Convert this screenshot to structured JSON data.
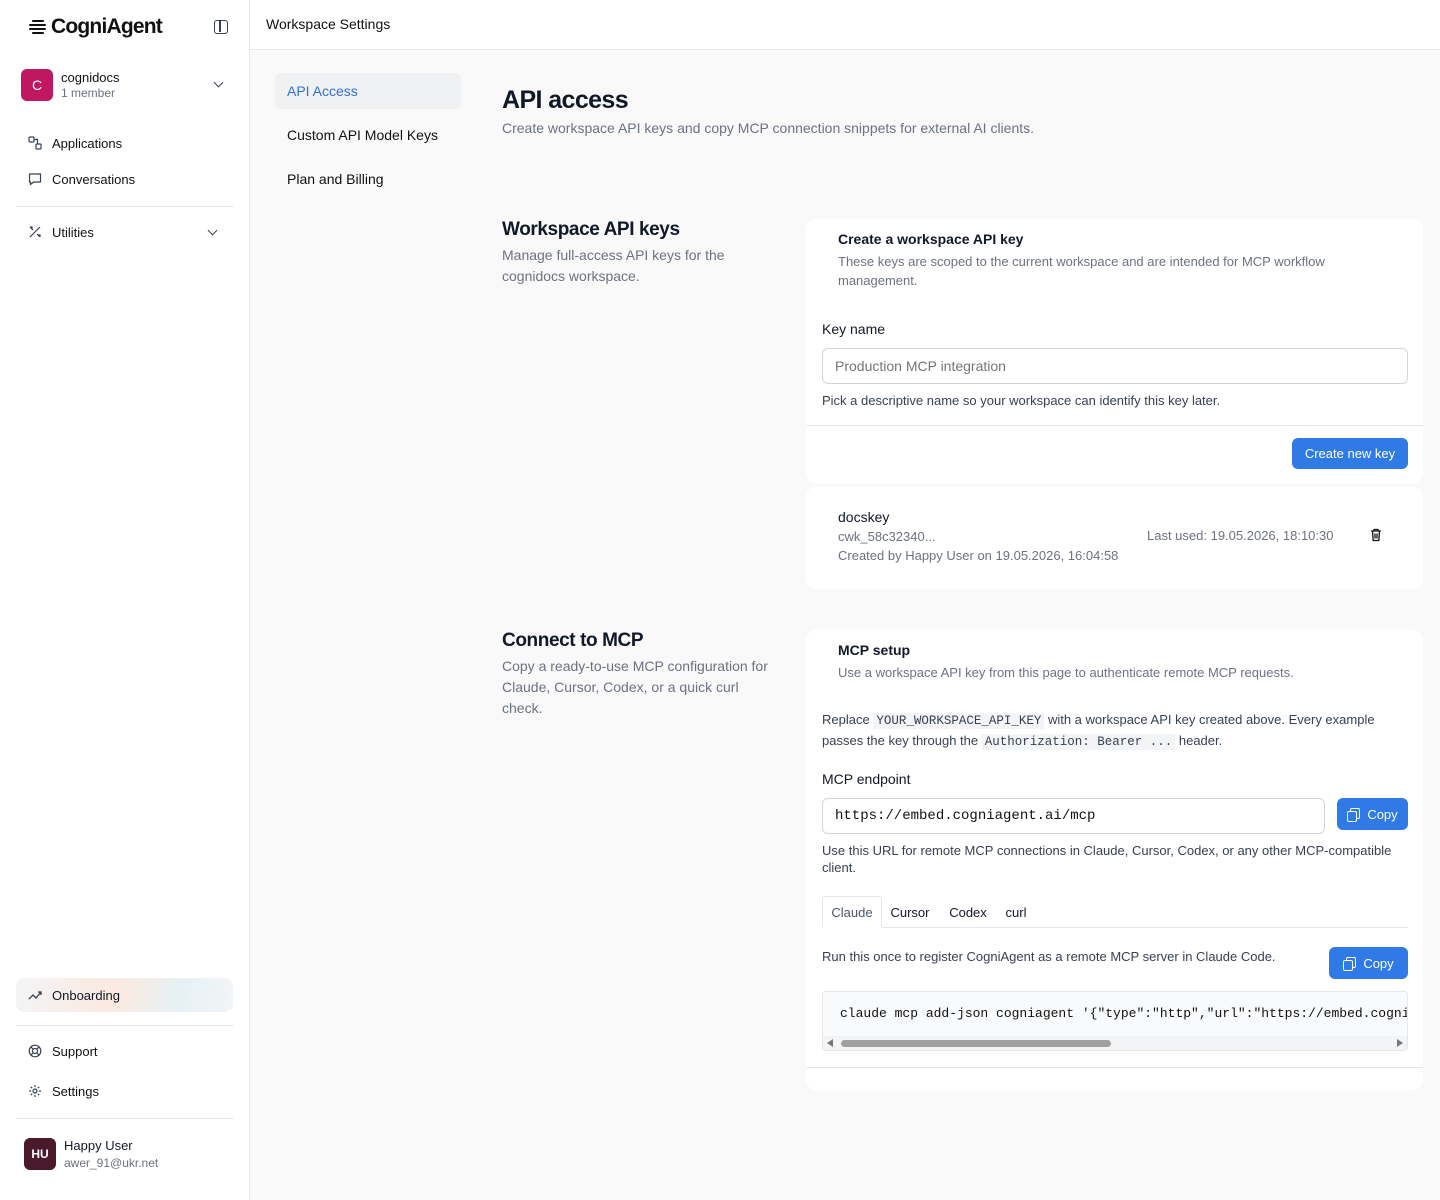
{
  "app": {
    "brand": "CogniAgent"
  },
  "workspace": {
    "initial": "C",
    "name": "cognidocs",
    "members": "1 member"
  },
  "sidebar": {
    "items": [
      {
        "label": "Applications",
        "icon": "applications-icon"
      },
      {
        "label": "Conversations",
        "icon": "chat-bubble-icon"
      },
      {
        "label": "Utilities",
        "icon": "tools-icon"
      }
    ],
    "onboarding": "Onboarding",
    "support": "Support",
    "settings": "Settings"
  },
  "user": {
    "initials": "HU",
    "name": "Happy User",
    "email": "awer_91@ukr.net"
  },
  "header": {
    "title": "Workspace Settings"
  },
  "subnav": {
    "api_access": "API Access",
    "custom_keys": "Custom API Model Keys",
    "billing": "Plan and Billing"
  },
  "page": {
    "title": "API access",
    "subtitle": "Create workspace API keys and copy MCP connection snippets for external AI clients."
  },
  "keys_section": {
    "title": "Workspace API keys",
    "desc": "Manage full-access API keys for the cognidocs workspace.",
    "card_title": "Create a workspace API key",
    "card_sub": "These keys are scoped to the current workspace and are intended for MCP workflow management.",
    "key_name_label": "Key name",
    "key_name_placeholder": "Production MCP integration",
    "key_name_hint": "Pick a descriptive name so your workspace can identify this key later.",
    "create_button": "Create new key",
    "existing_key": {
      "name": "docskey",
      "prefix": "cwk_58c32340...",
      "created": "Created by Happy User on 19.05.2026, 16:04:58",
      "last_used": "Last used: 19.05.2026, 18:10:30"
    }
  },
  "mcp_section": {
    "title": "Connect to MCP",
    "desc": "Copy a ready-to-use MCP configuration for Claude, Cursor, Codex, or a quick curl check.",
    "card_title": "MCP setup",
    "card_sub": "Use a workspace API key from this page to authenticate remote MCP requests.",
    "replace_1": "Replace ",
    "replace_code": "YOUR_WORKSPACE_API_KEY",
    "replace_2": " with a workspace API key created above. Every example passes the key through the ",
    "auth_code": "Authorization: Bearer ...",
    "replace_3": " header.",
    "endpoint_label": "MCP endpoint",
    "endpoint_value": "https://embed.cogniagent.ai/mcp",
    "copy_label": "Copy",
    "endpoint_hint": "Use this URL for remote MCP connections in Claude, Cursor, Codex, or any other MCP-compatible client.",
    "tabs": [
      "Claude",
      "Cursor",
      "Codex",
      "curl"
    ],
    "tab_desc": "Run this once to register CogniAgent as a remote MCP server in Claude Code.",
    "code": "claude mcp add-json cogniagent '{\"type\":\"http\",\"url\":\"https://embed.cogniagent.ai/mcp\",\"headers\":{\"Authorization\":\"Bearer YOUR_WORKSPACE_API_KEY\"}}'"
  },
  "colors": {
    "accent": "#2f7ae5",
    "active_nav_text": "#2f6fde",
    "workspace_avatar": "#c0185e",
    "user_avatar": "#4a1a2c"
  }
}
